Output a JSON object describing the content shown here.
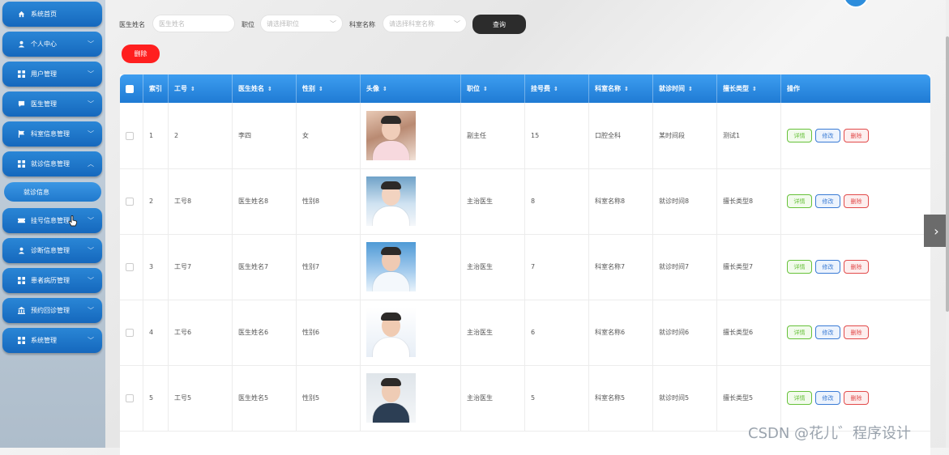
{
  "sidebar": {
    "items": [
      {
        "label": "系统首页",
        "icon": "home-icon",
        "chevron": false
      },
      {
        "label": "个人中心",
        "icon": "user-icon",
        "chevron": true
      },
      {
        "label": "用户管理",
        "icon": "grid-icon",
        "chevron": true
      },
      {
        "label": "医生管理",
        "icon": "chat-icon",
        "chevron": true
      },
      {
        "label": "科室信息管理",
        "icon": "flag-icon",
        "chevron": true
      },
      {
        "label": "就诊信息管理",
        "icon": "grid-icon",
        "chevron": true,
        "expanded": true
      },
      {
        "label": "挂号信息管理",
        "icon": "ticket-icon",
        "chevron": true
      },
      {
        "label": "诊断信息管理",
        "icon": "user-icon",
        "chevron": true
      },
      {
        "label": "患者病历管理",
        "icon": "grid-icon",
        "chevron": true
      },
      {
        "label": "预约回诊管理",
        "icon": "bank-icon",
        "chevron": true
      },
      {
        "label": "系统管理",
        "icon": "grid-icon",
        "chevron": true
      }
    ],
    "submenu": {
      "label": "就诊信息"
    }
  },
  "search": {
    "doctor_name_label": "医生姓名",
    "doctor_name_placeholder": "医生姓名",
    "position_label": "职位",
    "position_placeholder": "请选择职位",
    "dept_label": "科室名称",
    "dept_placeholder": "请选择科室名称",
    "query_button": "查询"
  },
  "toolbar": {
    "delete_button": "删除"
  },
  "table": {
    "headers": [
      "索引",
      "工号",
      "医生姓名",
      "性别",
      "头像",
      "职位",
      "挂号费",
      "科室名称",
      "就诊时间",
      "擅长类型",
      "操作"
    ],
    "action_labels": {
      "detail": "详情",
      "edit": "修改",
      "delete": "删除"
    },
    "rows": [
      {
        "index": "1",
        "job_no": "2",
        "name": "李四",
        "gender": "女",
        "position": "副主任",
        "fee": "15",
        "dept": "口腔全科",
        "time": "某时间段",
        "specialty": "测试1"
      },
      {
        "index": "2",
        "job_no": "工号8",
        "name": "医生姓名8",
        "gender": "性别8",
        "position": "主治医生",
        "fee": "8",
        "dept": "科室名称8",
        "time": "就诊时间8",
        "specialty": "擅长类型8"
      },
      {
        "index": "3",
        "job_no": "工号7",
        "name": "医生姓名7",
        "gender": "性别7",
        "position": "主治医生",
        "fee": "7",
        "dept": "科室名称7",
        "time": "就诊时间7",
        "specialty": "擅长类型7"
      },
      {
        "index": "4",
        "job_no": "工号6",
        "name": "医生姓名6",
        "gender": "性别6",
        "position": "主治医生",
        "fee": "6",
        "dept": "科室名称6",
        "time": "就诊时间6",
        "specialty": "擅长类型6"
      },
      {
        "index": "5",
        "job_no": "工号5",
        "name": "医生姓名5",
        "gender": "性别5",
        "position": "主治医生",
        "fee": "5",
        "dept": "科室名称5",
        "time": "就诊时间5",
        "specialty": "擅长类型5"
      }
    ]
  },
  "watermark": "CSDN @花儿゛程序设计",
  "colors": {
    "accent": "#1f7bd4",
    "danger": "#ff1f1f",
    "success": "#67c23a"
  }
}
